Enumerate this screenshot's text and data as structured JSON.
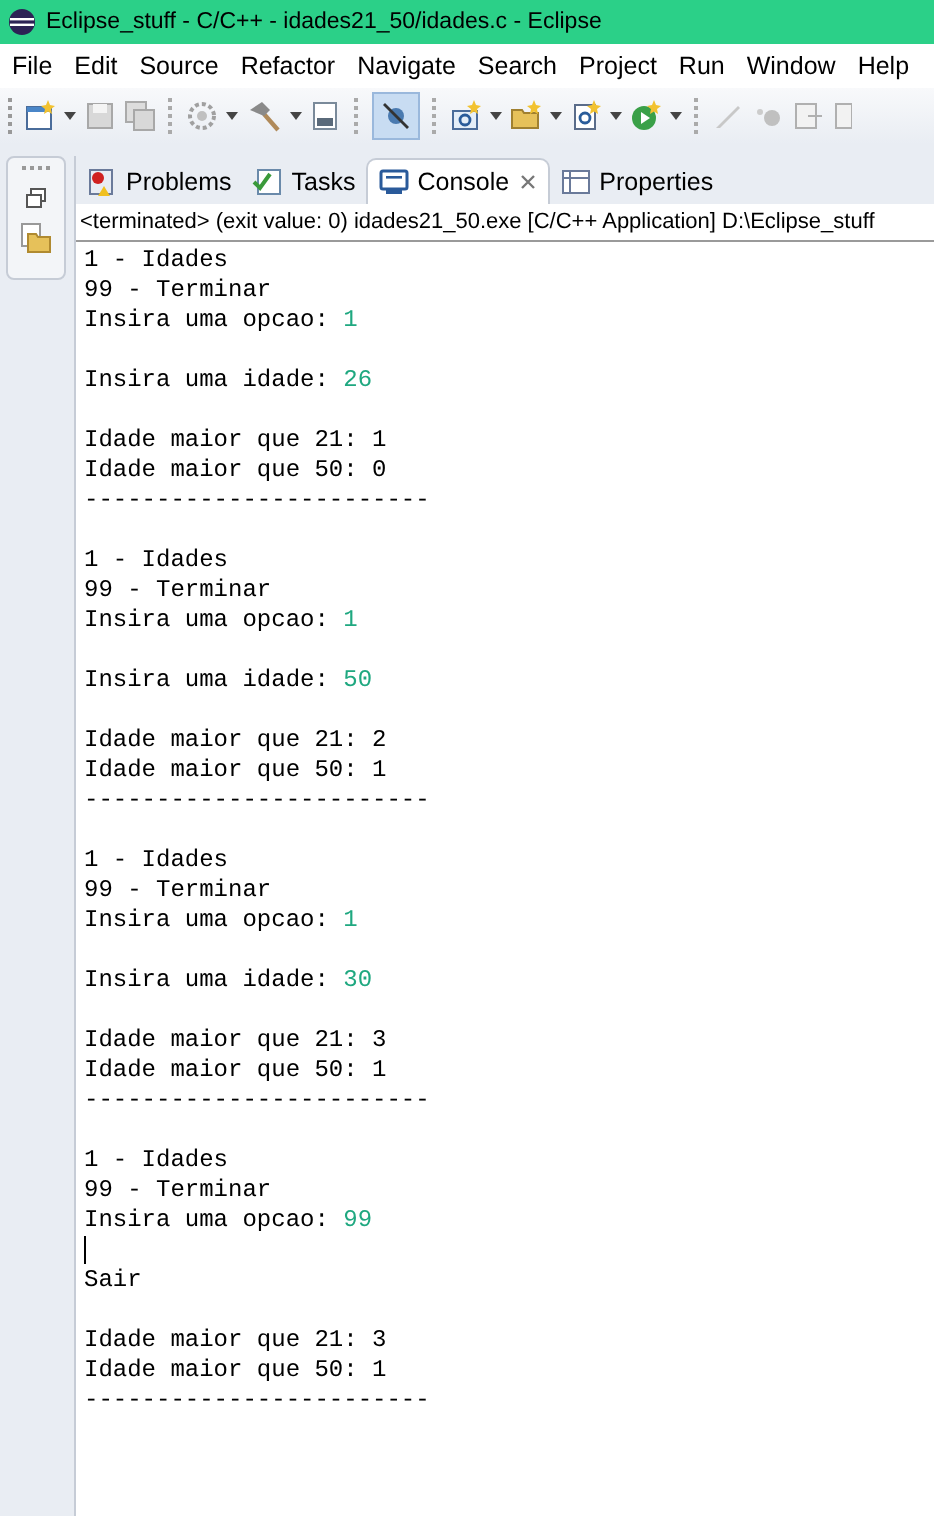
{
  "window": {
    "title": "Eclipse_stuff - C/C++ - idades21_50/idades.c - Eclipse"
  },
  "menu": [
    "File",
    "Edit",
    "Source",
    "Refactor",
    "Navigate",
    "Search",
    "Project",
    "Run",
    "Window",
    "Help"
  ],
  "tabs": [
    {
      "label": "Problems",
      "kind": "problems",
      "selected": false
    },
    {
      "label": "Tasks",
      "kind": "tasks",
      "selected": false
    },
    {
      "label": "Console",
      "kind": "console",
      "selected": true
    },
    {
      "label": "Properties",
      "kind": "properties",
      "selected": false
    }
  ],
  "console": {
    "header": "<terminated> (exit value: 0) idades21_50.exe [C/C++ Application] D:\\Eclipse_stuff",
    "lines": [
      {
        "kind": "out",
        "text": "1 - Idades"
      },
      {
        "kind": "out",
        "text": "99 - Terminar"
      },
      {
        "kind": "out",
        "text": "Insira uma opcao: ",
        "input": "1"
      },
      {
        "kind": "blank"
      },
      {
        "kind": "out",
        "text": "Insira uma idade: ",
        "input": "26"
      },
      {
        "kind": "blank"
      },
      {
        "kind": "out",
        "text": "Idade maior que 21: 1"
      },
      {
        "kind": "out",
        "text": "Idade maior que 50: 0"
      },
      {
        "kind": "out",
        "text": "------------------------"
      },
      {
        "kind": "blank"
      },
      {
        "kind": "out",
        "text": "1 - Idades"
      },
      {
        "kind": "out",
        "text": "99 - Terminar"
      },
      {
        "kind": "out",
        "text": "Insira uma opcao: ",
        "input": "1"
      },
      {
        "kind": "blank"
      },
      {
        "kind": "out",
        "text": "Insira uma idade: ",
        "input": "50"
      },
      {
        "kind": "blank"
      },
      {
        "kind": "out",
        "text": "Idade maior que 21: 2"
      },
      {
        "kind": "out",
        "text": "Idade maior que 50: 1"
      },
      {
        "kind": "out",
        "text": "------------------------"
      },
      {
        "kind": "blank"
      },
      {
        "kind": "out",
        "text": "1 - Idades"
      },
      {
        "kind": "out",
        "text": "99 - Terminar"
      },
      {
        "kind": "out",
        "text": "Insira uma opcao: ",
        "input": "1"
      },
      {
        "kind": "blank"
      },
      {
        "kind": "out",
        "text": "Insira uma idade: ",
        "input": "30"
      },
      {
        "kind": "blank"
      },
      {
        "kind": "out",
        "text": "Idade maior que 21: 3"
      },
      {
        "kind": "out",
        "text": "Idade maior que 50: 1"
      },
      {
        "kind": "out",
        "text": "------------------------"
      },
      {
        "kind": "blank"
      },
      {
        "kind": "out",
        "text": "1 - Idades"
      },
      {
        "kind": "out",
        "text": "99 - Terminar"
      },
      {
        "kind": "out",
        "text": "Insira uma opcao: ",
        "input": "99"
      },
      {
        "kind": "cursor"
      },
      {
        "kind": "out",
        "text": "Sair"
      },
      {
        "kind": "blank"
      },
      {
        "kind": "out",
        "text": "Idade maior que 21: 3"
      },
      {
        "kind": "out",
        "text": "Idade maior que 50: 1"
      },
      {
        "kind": "out",
        "text": "------------------------"
      }
    ]
  }
}
